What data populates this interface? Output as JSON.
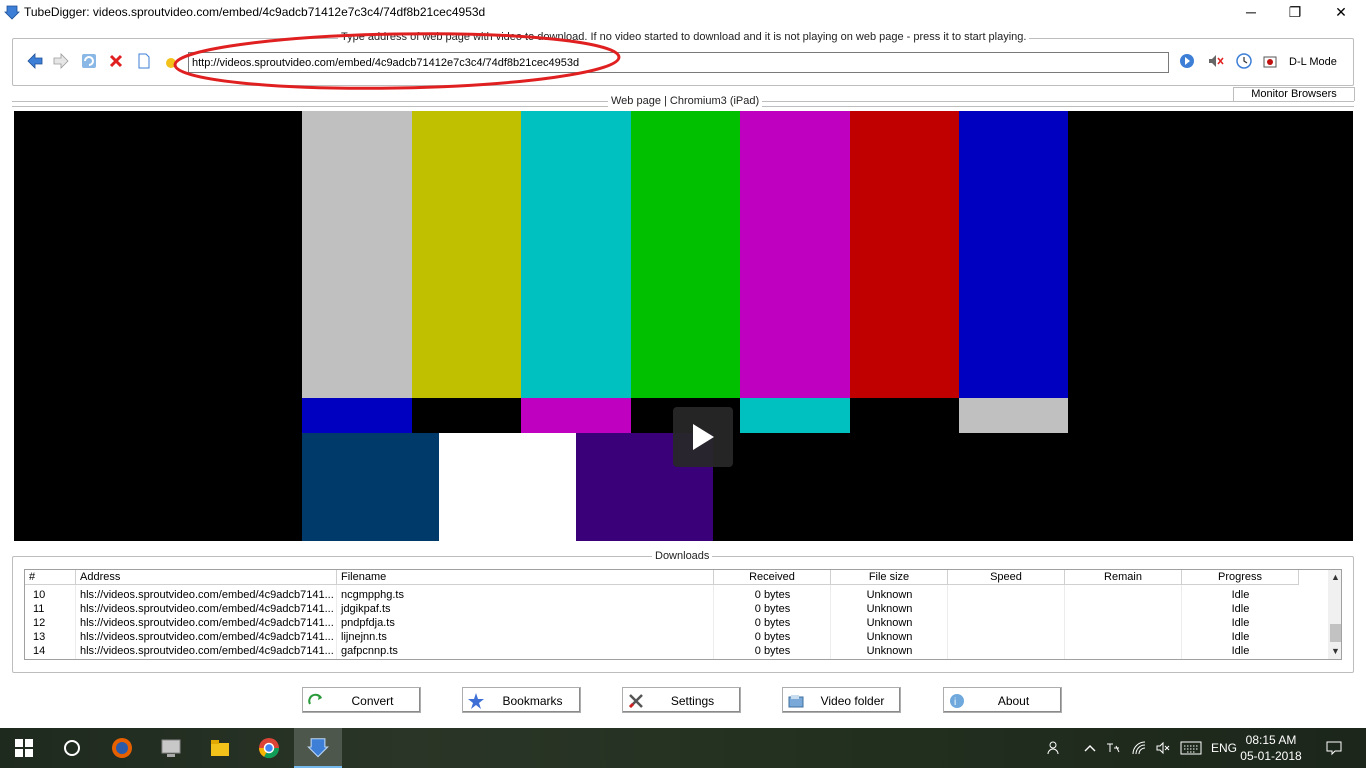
{
  "window": {
    "title": "TubeDigger: videos.sproutvideo.com/embed/4c9adcb71412e7c3c4/74df8b21cec4953d",
    "minimize": "─",
    "restore": "❐",
    "close": "✕"
  },
  "address_bar": {
    "group_label": "Type address of web page with video to download. If no video started to download and it is not playing on web page - press it to start playing.",
    "url": "http://videos.sproutvideo.com/embed/4c9adcb71412e7c3c4/74df8b21cec4953d",
    "dl_mode_label": "D-L Mode",
    "toolbar_icons": [
      "back-icon",
      "forward-icon",
      "refresh-icon",
      "stop-icon",
      "page-icon",
      "bookmark-icon"
    ],
    "right_icons": [
      "go-icon",
      "mute-icon",
      "clock-icon",
      "record-icon"
    ]
  },
  "web_page": {
    "label": "Web page | Chromium3 (iPad)",
    "monitor_browsers": "Monitor Browsers"
  },
  "video": {
    "color_bars_top": [
      "#c0c0c0",
      "#c0c000",
      "#00c0c0",
      "#00c000",
      "#c000c0",
      "#c00000",
      "#0000c0"
    ],
    "color_bars_mid": [
      "#0000c0",
      "#000000",
      "#c000c0",
      "#000000",
      "#00c0c0",
      "#000000",
      "#c0c0c0"
    ],
    "color_bars_bottom": [
      "#003a6b",
      "#ffffff",
      "#3a007a",
      "#000000"
    ],
    "play_icon": "play-icon"
  },
  "downloads": {
    "label": "Downloads",
    "columns": [
      "#",
      "Address",
      "Filename",
      "Received",
      "File size",
      "Speed",
      "Remain",
      "Progress"
    ],
    "rows": [
      {
        "num": "10",
        "address": "hls://videos.sproutvideo.com/embed/4c9adcb7141...",
        "filename": "ncgmpphg.ts",
        "received": "0 bytes",
        "size": "Unknown",
        "speed": "",
        "remain": "",
        "progress": "Idle"
      },
      {
        "num": "11",
        "address": "hls://videos.sproutvideo.com/embed/4c9adcb7141...",
        "filename": "jdgikpaf.ts",
        "received": "0 bytes",
        "size": "Unknown",
        "speed": "",
        "remain": "",
        "progress": "Idle"
      },
      {
        "num": "12",
        "address": "hls://videos.sproutvideo.com/embed/4c9adcb7141...",
        "filename": "pndpfdja.ts",
        "received": "0 bytes",
        "size": "Unknown",
        "speed": "",
        "remain": "",
        "progress": "Idle"
      },
      {
        "num": "13",
        "address": "hls://videos.sproutvideo.com/embed/4c9adcb7141...",
        "filename": "lijnejnn.ts",
        "received": "0 bytes",
        "size": "Unknown",
        "speed": "",
        "remain": "",
        "progress": "Idle"
      },
      {
        "num": "14",
        "address": "hls://videos.sproutvideo.com/embed/4c9adcb7141...",
        "filename": "gafpcnnp.ts",
        "received": "0 bytes",
        "size": "Unknown",
        "speed": "",
        "remain": "",
        "progress": "Idle"
      }
    ]
  },
  "buttons": {
    "convert": "Convert",
    "bookmarks": "Bookmarks",
    "settings": "Settings",
    "video_folder": "Video folder",
    "about": "About"
  },
  "taskbar": {
    "language": "ENG",
    "time": "08:15 AM",
    "date": "05-01-2018",
    "apps": [
      "windows-start-icon",
      "cortana-icon",
      "firefox-icon",
      "computer-icon",
      "file-explorer-icon",
      "chrome-icon",
      "tubedigger-icon"
    ]
  },
  "colors": {
    "annotation": "#e02020",
    "accent": "#3d7fd6"
  }
}
